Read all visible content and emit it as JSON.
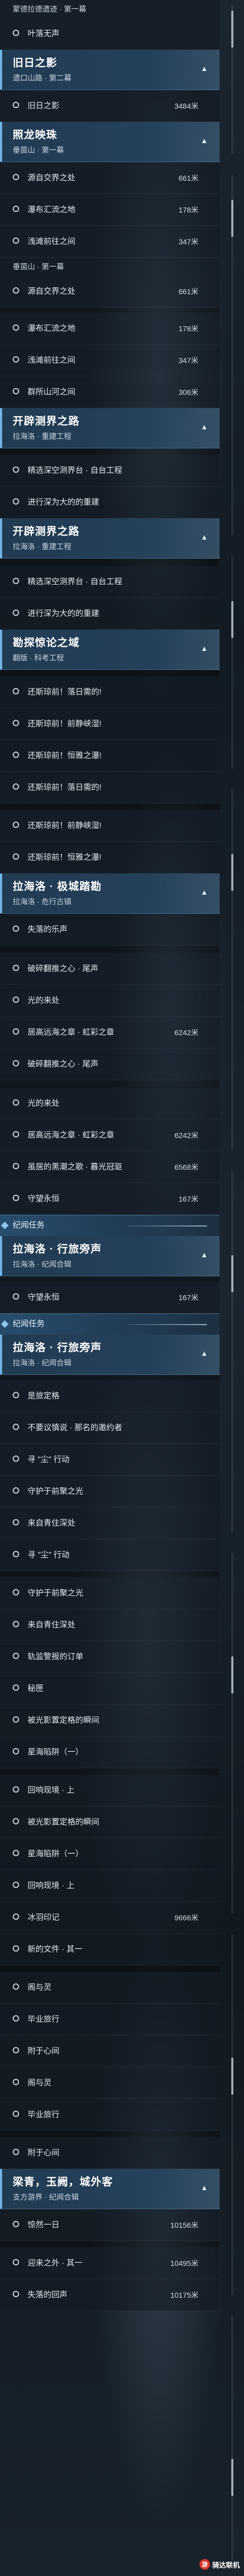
{
  "sections": [
    {
      "kind": "subtitle",
      "text": "蒙德拉德遗迹 · 第一幕"
    },
    {
      "kind": "item",
      "label": "叶落无声",
      "dist": ""
    },
    {
      "kind": "header",
      "title": "旧日之影",
      "subtitle": "遗口山路 · 第二幕"
    },
    {
      "kind": "item",
      "label": "旧日之影",
      "dist": "3484米"
    },
    {
      "kind": "header",
      "title": "照龙映珠",
      "subtitle": "垂茵山 · 第一幕"
    },
    {
      "kind": "item",
      "label": "源自交界之处",
      "dist": "661米"
    },
    {
      "kind": "item",
      "label": "瀑布汇流之地",
      "dist": "178米"
    },
    {
      "kind": "item",
      "label": "浅滩前往之间",
      "dist": "347米"
    },
    {
      "kind": "subtitle",
      "text": "垂茵山 · 第一幕"
    },
    {
      "kind": "item",
      "label": "源自交界之处",
      "dist": "661米"
    },
    {
      "kind": "item",
      "label": "瀑布汇流之地",
      "dist": "178米"
    },
    {
      "kind": "item",
      "label": "浅滩前往之间",
      "dist": "347米"
    },
    {
      "kind": "item",
      "label": "群所山河之间",
      "dist": "306米"
    },
    {
      "kind": "header",
      "title": "开辟测界之路",
      "subtitle": "拉海洛 · 重建工程"
    },
    {
      "kind": "item",
      "label": "精选深空测界台 · 自台工程",
      "dist": ""
    },
    {
      "kind": "item",
      "label": "进行深为大的的重建",
      "dist": ""
    },
    {
      "kind": "header",
      "title": "开辟测界之路",
      "subtitle": "拉海洛 · 重建工程"
    },
    {
      "kind": "item",
      "label": "精选深空测界台 · 自台工程",
      "dist": ""
    },
    {
      "kind": "item",
      "label": "进行深为大的的重建",
      "dist": ""
    },
    {
      "kind": "header",
      "title": "勘探惊论之域",
      "subtitle": "翻版 · 科考工程"
    },
    {
      "kind": "item",
      "label": "还斯琼前！落日需的!",
      "dist": ""
    },
    {
      "kind": "item",
      "label": "还斯琼前！前静峡湿!",
      "dist": ""
    },
    {
      "kind": "item",
      "label": "还斯琼前！恒雅之瀑!",
      "dist": ""
    },
    {
      "kind": "item",
      "label": "还斯琼前！落日需的!",
      "dist": ""
    },
    {
      "kind": "item",
      "label": "还斯琼前！前静峡湿!",
      "dist": ""
    },
    {
      "kind": "item",
      "label": "还斯琼前！恒雅之瀑!",
      "dist": ""
    },
    {
      "kind": "header",
      "title": "拉海洛 · 极城踏勘",
      "subtitle": "拉海洛 · 危行古镇"
    },
    {
      "kind": "item",
      "label": "失落的乐声",
      "dist": ""
    },
    {
      "kind": "item",
      "label": "破碎翻推之心 · 尾声",
      "dist": ""
    },
    {
      "kind": "item",
      "label": "光的来处",
      "dist": ""
    },
    {
      "kind": "item",
      "label": "居高远海之章 · 虹彩之章",
      "dist": "6242米"
    },
    {
      "kind": "item",
      "label": "破碎翻推之心 · 尾声",
      "dist": ""
    },
    {
      "kind": "item",
      "label": "光的来处",
      "dist": ""
    },
    {
      "kind": "item",
      "label": "居高远海之章 · 虹彩之章",
      "dist": "6242米"
    },
    {
      "kind": "item",
      "label": "虽居的黑潮之歌 · 暮光冠驱",
      "dist": "6568米"
    },
    {
      "kind": "item",
      "label": "守望永恒",
      "dist": "167米"
    },
    {
      "kind": "cat",
      "text": "纪闻任务"
    },
    {
      "kind": "header",
      "title": "拉海洛 · 行旅旁声",
      "subtitle": "拉海洛 · 纪闻合辑"
    },
    {
      "kind": "item",
      "label": "守望永恒",
      "dist": "167米"
    },
    {
      "kind": "cat",
      "text": "纪闻任务"
    },
    {
      "kind": "header",
      "title": "拉海洛 · 行旅旁声",
      "subtitle": "拉海洛 · 纪闻合辑"
    },
    {
      "kind": "item",
      "label": "是旅定格",
      "dist": ""
    },
    {
      "kind": "item",
      "label": "不要议慎说 · 那名的邀约者",
      "dist": ""
    },
    {
      "kind": "item",
      "label": "寻 \"尘\" 行动",
      "dist": ""
    },
    {
      "kind": "item",
      "label": "守护于前聚之光",
      "dist": ""
    },
    {
      "kind": "item",
      "label": "来自青住深处",
      "dist": ""
    },
    {
      "kind": "item",
      "label": "寻 \"尘\" 行动",
      "dist": ""
    },
    {
      "kind": "item",
      "label": "守护于前聚之光",
      "dist": ""
    },
    {
      "kind": "item",
      "label": "来自青住深处",
      "dist": ""
    },
    {
      "kind": "item",
      "label": "轨监警报的订单",
      "dist": ""
    },
    {
      "kind": "item",
      "label": "秘匣",
      "dist": ""
    },
    {
      "kind": "item",
      "label": "被光影置定格的瞬间",
      "dist": ""
    },
    {
      "kind": "item",
      "label": "星海陷阱（一）",
      "dist": ""
    },
    {
      "kind": "item",
      "label": "回响现境 · 上",
      "dist": ""
    },
    {
      "kind": "item",
      "label": "被光影置定格的瞬间",
      "dist": ""
    },
    {
      "kind": "item",
      "label": "星海陷阱（一）",
      "dist": ""
    },
    {
      "kind": "item",
      "label": "回响现境 · 上",
      "dist": ""
    },
    {
      "kind": "item",
      "label": "冰羽印记",
      "dist": "9666米"
    },
    {
      "kind": "item",
      "label": "新的文件 · 其一",
      "dist": ""
    },
    {
      "kind": "item",
      "label": "阁与灵",
      "dist": ""
    },
    {
      "kind": "item",
      "label": "毕业旅行",
      "dist": ""
    },
    {
      "kind": "item",
      "label": "附于心间",
      "dist": ""
    },
    {
      "kind": "item",
      "label": "阁与灵",
      "dist": ""
    },
    {
      "kind": "item",
      "label": "毕业旅行",
      "dist": ""
    },
    {
      "kind": "item",
      "label": "附于心间",
      "dist": ""
    },
    {
      "kind": "header",
      "title": "梁青，玉阙，城外客",
      "subtitle": "支方游界 · 纪闻合辑"
    },
    {
      "kind": "item",
      "label": "惊然一日",
      "dist": "10156米"
    },
    {
      "kind": "item",
      "label": "迎来之外 · 其一",
      "dist": "10495米"
    },
    {
      "kind": "item",
      "label": "失落的回声",
      "dist": "10175米"
    }
  ],
  "watermark": {
    "logo": "游",
    "text": "骑达联机"
  },
  "icons": {
    "collapse": "chevron-up-icon",
    "dot": "circle-bullet-icon"
  }
}
